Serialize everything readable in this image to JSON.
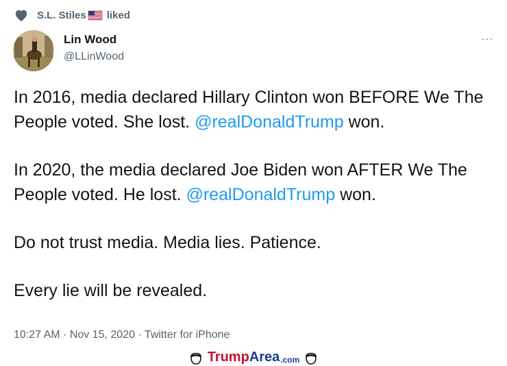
{
  "social_context": {
    "icon": "heart-icon",
    "liker": "S.L. Stiles",
    "flag": "us-flag-icon",
    "action": "liked"
  },
  "author": {
    "name": "Lin Wood",
    "handle": "@LLinWood"
  },
  "tweet": {
    "p1_before": "In 2016, media declared Hillary Clinton won BEFORE We The People voted. She lost. ",
    "p1_mention": "@realDonaldTrump",
    "p1_after": " won.",
    "p2_before": "In 2020, the media declared Joe Biden won AFTER We The People voted. He lost. ",
    "p2_mention": "@realDonaldTrump",
    "p2_after": " won.",
    "p3": "Do not trust media. Media lies. Patience.",
    "p4": "Every lie will be revealed."
  },
  "meta": {
    "text": "10:27 AM · Nov 15, 2020 · Twitter for iPhone"
  },
  "more_icon": "···",
  "watermark": {
    "part1": "Trump",
    "part2": "Area",
    "part3": ".com"
  },
  "colors": {
    "mention": "#1d9bf0",
    "secondary_text": "#536471",
    "watermark_red": "#c8102e",
    "watermark_blue": "#1a3b8f"
  }
}
